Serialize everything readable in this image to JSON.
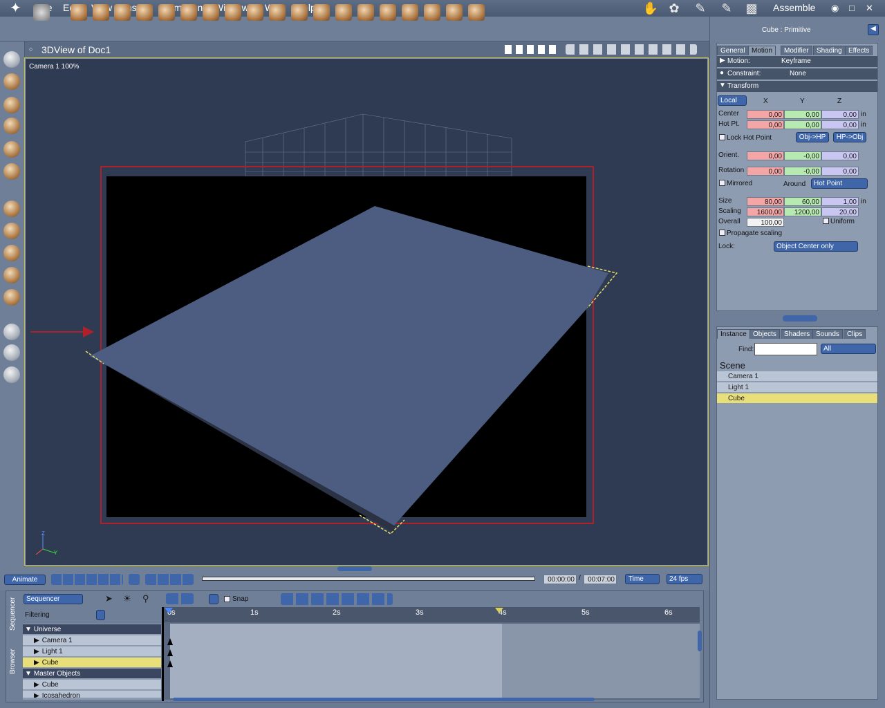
{
  "menubar": {
    "items": [
      "File",
      "Edit",
      "View",
      "Insert",
      "Animation",
      "Windows",
      "Web",
      "Help"
    ],
    "mode": "Assemble"
  },
  "viewport": {
    "title": "3DView of Doc1",
    "camera_label": "Camera 1 100%"
  },
  "properties": {
    "title": "Cube : Primitive",
    "tabs": [
      "General",
      "Motion",
      "Modifier",
      "Shading",
      "Effects"
    ],
    "active_tab": "Motion",
    "motion_label": "Motion:",
    "motion_value": "Keyframe",
    "constraint_label": "Constraint:",
    "constraint_value": "None",
    "transform_label": "Transform",
    "space_value": "Local",
    "col_x": "X",
    "col_y": "Y",
    "col_z": "Z",
    "center_label": "Center",
    "center": [
      "0,00",
      "0,00",
      "0,00"
    ],
    "hotpt_label": "Hot Pt.",
    "hotpt": [
      "0,00",
      "0,00",
      "0,00"
    ],
    "unit": "in",
    "lock_hotpoint": "Lock Hot Point",
    "objhp_btn": "Obj->HP",
    "hpobj_btn": "HP->Obj",
    "orient_label": "Orient.",
    "orient": [
      "0,00",
      "-0,00",
      "0,00"
    ],
    "rotation_label": "Rotation",
    "rotation": [
      "0,00",
      "-0,00",
      "0,00"
    ],
    "mirrored": "Mirrored",
    "around_label": "Around",
    "around_value": "Hot Point",
    "size_label": "Size",
    "size": [
      "80,00",
      "60,00",
      "1,00"
    ],
    "scaling_label": "Scaling",
    "scaling": [
      "1600,00",
      "1200,00",
      "20,00"
    ],
    "overall_label": "Overall",
    "overall": "100,00",
    "uniform": "Uniform",
    "propagate": "Propagate scaling",
    "lock_label": "Lock:",
    "lock_value": "Object Center only"
  },
  "instance": {
    "tabs": [
      "Instance",
      "Objects",
      "Shaders",
      "Sounds",
      "Clips"
    ],
    "active_tab": "Instance",
    "find_label": "Find:",
    "filter_value": "All",
    "scene_label": "Scene",
    "items": [
      "Camera 1",
      "Light 1",
      "Cube"
    ],
    "selected": "Cube"
  },
  "animation": {
    "animate_btn": "Animate",
    "time_current": "00:00:00",
    "time_end": "00:07:00",
    "time_mode": "Time",
    "fps": "24 fps"
  },
  "sequencer": {
    "mode": "Sequencer",
    "filtering": "Filtering",
    "snap": "Snap",
    "side_tabs": [
      "Sequencer",
      "Browser"
    ],
    "ruler": [
      "0s",
      "1s",
      "2s",
      "3s",
      "4s",
      "5s",
      "6s"
    ],
    "tracks": [
      {
        "label": "Universe",
        "group": true
      },
      {
        "label": "Camera 1",
        "group": false
      },
      {
        "label": "Light 1",
        "group": false
      },
      {
        "label": "Cube",
        "group": false,
        "selected": true
      },
      {
        "label": "Master Objects",
        "group": true
      },
      {
        "label": "Cube",
        "group": false
      },
      {
        "label": "Icosahedron",
        "group": false
      }
    ]
  }
}
